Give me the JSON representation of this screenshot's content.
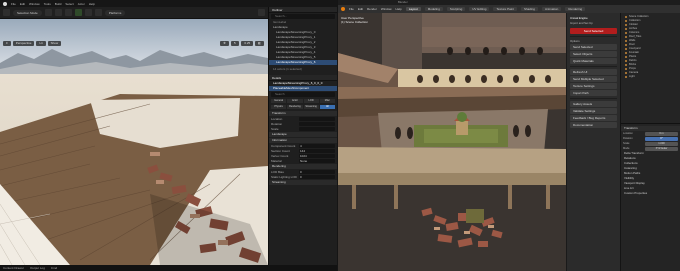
{
  "ue": {
    "menu": [
      "File",
      "Edit",
      "Window",
      "Tools",
      "Build",
      "Select",
      "Actor",
      "Help"
    ],
    "toolbar": {
      "mode": "Selection Mode",
      "platforms": "Platforms"
    },
    "viewport": {
      "perspective": "Perspective",
      "lit": "Lit",
      "show": "Show",
      "scale": "0.25"
    },
    "outliner": {
      "title": "Outliner",
      "search_placeholder": "Search...",
      "items": [
        "ItemLabel",
        "Landscape",
        "LandscapeStreamingProxy_0",
        "LandscapeStreamingProxy_1",
        "LandscapeStreamingProxy_2",
        "LandscapeStreamingProxy_3",
        "LandscapeStreamingProxy_4",
        "LandscapeStreamingProxy_5",
        "LandscapeStreamingProxy_6"
      ],
      "count": "14 actors (1 selected)"
    },
    "details": {
      "title": "Details",
      "selected": "LandscapeStreamingProxy_6_0_0_0",
      "component": "PlaceableMeshComponent",
      "search_placeholder": "Search",
      "tabs": [
        "General",
        "Actor",
        "LOD",
        "Misc",
        "Physics",
        "Rendering",
        "Streaming",
        "All"
      ],
      "sections": [
        "Transform",
        "Location",
        "Rotation",
        "Scale",
        "Landscape",
        "Information",
        "Rendering",
        "Streaming"
      ],
      "rows": [
        {
          "label": "Component Count",
          "value": "4"
        },
        {
          "label": "Section Count",
          "value": "144"
        },
        {
          "label": "Vertex Count",
          "value": "1024"
        },
        {
          "label": "Material",
          "value": "None"
        },
        {
          "label": "LOD Bias",
          "value": "0"
        },
        {
          "label": "Static Lighting LOD",
          "value": "0"
        }
      ]
    },
    "status": {
      "content_drawer": "Content Drawer",
      "output_log": "Output Log",
      "cmd": "Cmd"
    }
  },
  "blender": {
    "title": "Blender",
    "menu": [
      "File",
      "Edit",
      "Render",
      "Window",
      "Help"
    ],
    "workspaces": [
      "Layout",
      "Modeling",
      "Sculpting",
      "UV Editing",
      "Texture Paint",
      "Shading",
      "Animation",
      "Rendering",
      "Compositing",
      "Scripting"
    ],
    "active_workspace": "Layout",
    "hud": {
      "view": "User Perspective",
      "collection": "(1) Scene Collection"
    },
    "npanel": {
      "header": "Unreal Engine",
      "top_row": "Import and Set Up",
      "red_button": "Send Selected",
      "items": [
        "Options",
        "Send Selected",
        "Select Objects",
        "Quick Materials",
        "Refresh UI",
        "Send Multiple Selected",
        "Texture Settings",
        "Import Path",
        "Gallery Assets",
        "Validate Settings",
        "Feedback / Bug Reports",
        "Documentation"
      ]
    },
    "outliner": {
      "items": [
        "Scene Collection",
        "Collection",
        "Cloister",
        "Arches",
        "Columns",
        "Roof_Tiles",
        "Walls",
        "Floor",
        "Courtyard",
        "Fountain",
        "Plants",
        "Debris",
        "Bricks",
        "Props",
        "Camera",
        "Light"
      ]
    },
    "properties": {
      "header": "Transform",
      "rows": [
        {
          "label": "Location",
          "value": "0 m",
          "selected": false
        },
        {
          "label": "Rotation",
          "value": "0°",
          "selected": true
        },
        {
          "label": "Scale",
          "value": "1.000",
          "selected": false
        },
        {
          "label": "Mode",
          "value": "XYZ Euler",
          "selected": false
        }
      ],
      "sections": [
        "Delta Transform",
        "Relations",
        "Collections",
        "Instancing",
        "Motion Paths",
        "Visibility",
        "Viewport Display",
        "Line Art",
        "Custom Properties"
      ]
    }
  }
}
